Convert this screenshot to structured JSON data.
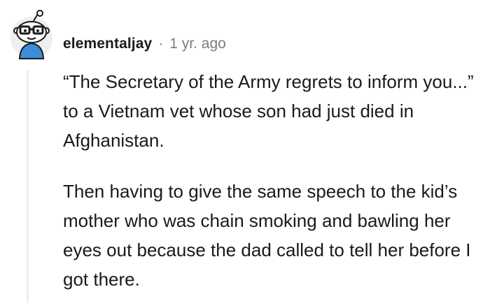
{
  "comment": {
    "author": "elementaljay",
    "separator": "·",
    "timestamp": "1 yr. ago",
    "avatar_icon": "reddit-snoo-avatar-with-glasses-icon",
    "paragraphs": [
      "“The Secretary of the Army regrets to inform you...” to a Vietnam vet whose son had just died in Afghanistan.",
      "Then having to give the same speech to the kid’s mother who was chain smoking and bawling her eyes out because the dad called to tell her before I got there."
    ]
  },
  "colors": {
    "text": "#1a1a1b",
    "meta": "#7c7c7c",
    "thread_line": "#edeff1",
    "avatar_shirt": "#3a8ddb"
  }
}
